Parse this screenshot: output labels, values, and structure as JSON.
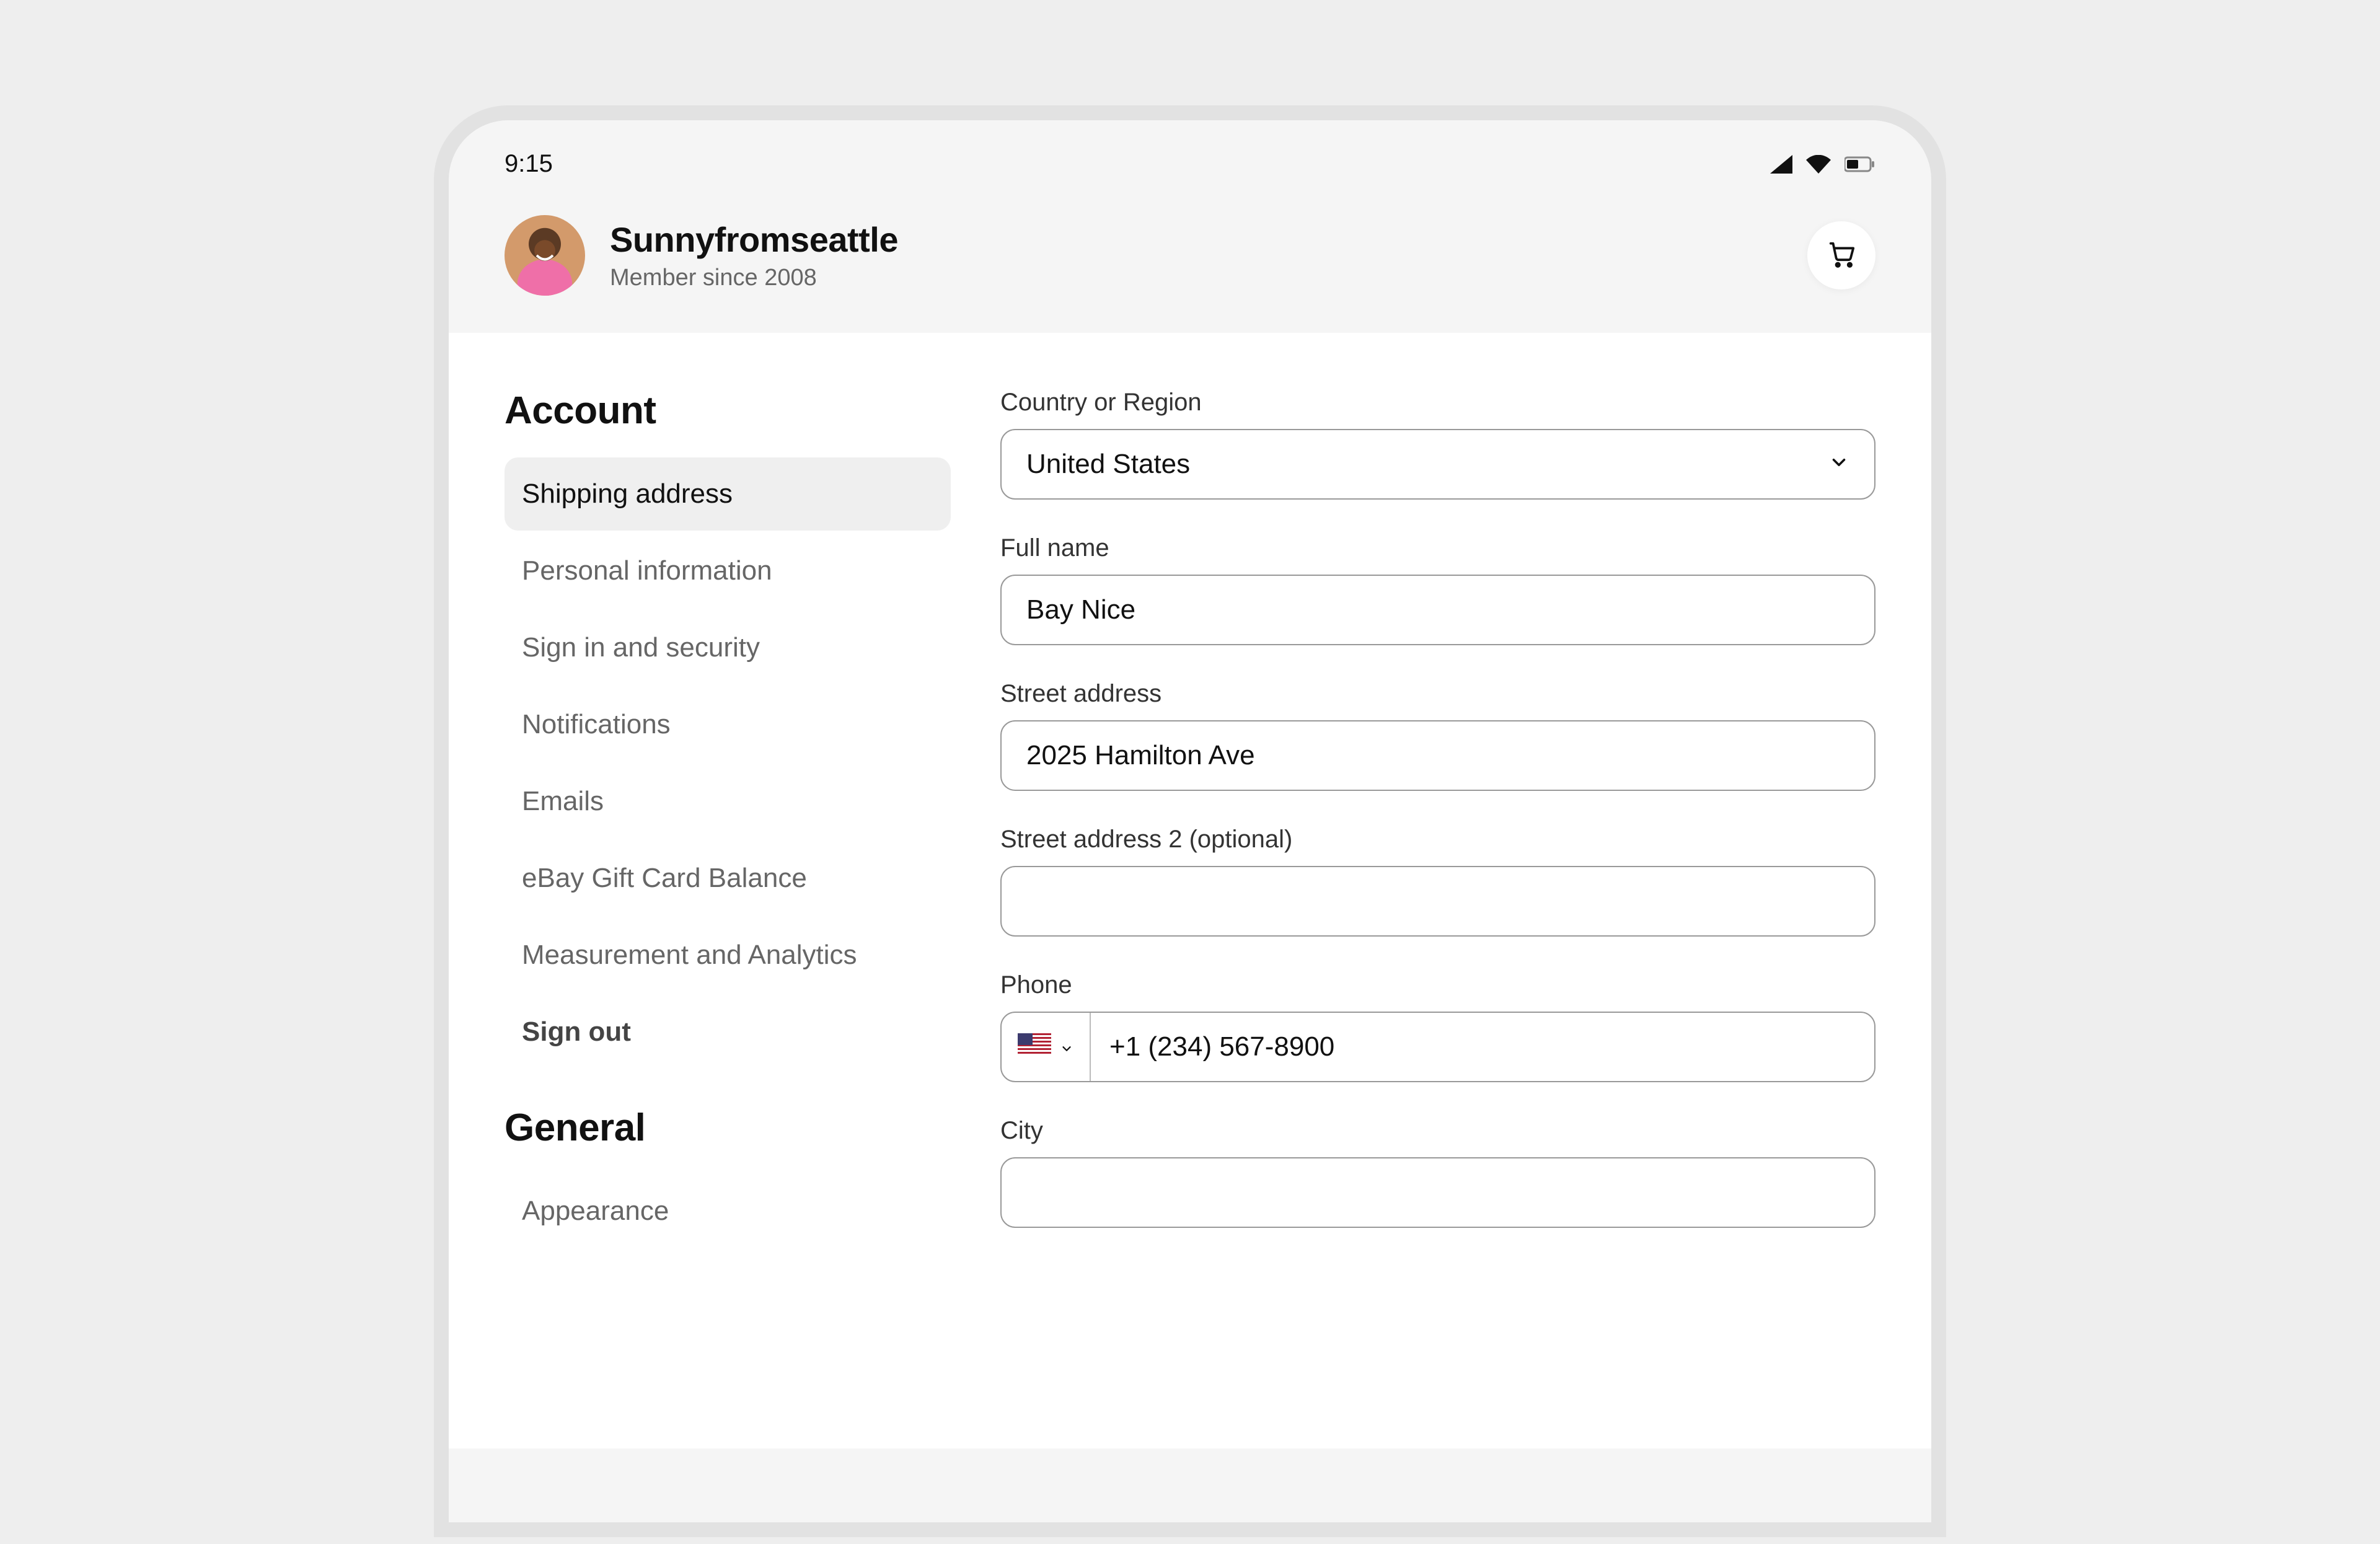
{
  "status": {
    "time": "9:15"
  },
  "header": {
    "username": "Sunnyfromseattle",
    "member_since": "Member since 2008"
  },
  "sidebar": {
    "account_heading": "Account",
    "general_heading": "General",
    "items": {
      "shipping_address": "Shipping address",
      "personal_information": "Personal information",
      "sign_in_security": "Sign in and security",
      "notifications": "Notifications",
      "emails": "Emails",
      "gift_card_balance": "eBay Gift Card Balance",
      "measurement_analytics": "Measurement and Analytics",
      "sign_out": "Sign out",
      "appearance": "Appearance"
    }
  },
  "form": {
    "country_label": "Country or Region",
    "country_value": "United States",
    "fullname_label": "Full name",
    "fullname_value": "Bay Nice",
    "street1_label": "Street address",
    "street1_value": "2025 Hamilton Ave",
    "street2_label": "Street address 2 (optional)",
    "street2_value": "",
    "phone_label": "Phone",
    "phone_value": "+1 (234) 567-8900",
    "phone_country": "US",
    "city_label": "City",
    "city_value": ""
  }
}
